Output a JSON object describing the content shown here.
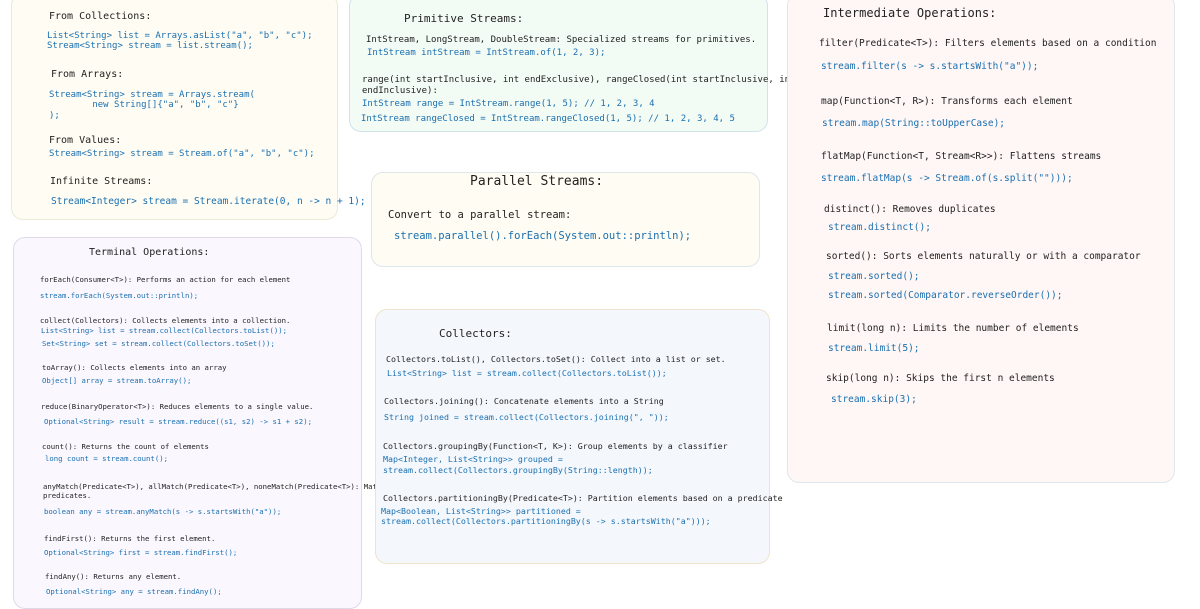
{
  "creation": {
    "from_collections": {
      "heading": "From Collections:",
      "code": [
        "List<String> list = Arrays.asList(\"a\", \"b\", \"c\");",
        "Stream<String> stream = list.stream();"
      ]
    },
    "from_arrays": {
      "heading": "From Arrays:",
      "code": [
        "Stream<String> stream = Arrays.stream(",
        "        new String[]{\"a\", \"b\", \"c\"}",
        ");"
      ]
    },
    "from_values": {
      "heading": "From Values:",
      "code": "Stream<String> stream = Stream.of(\"a\", \"b\", \"c\");"
    },
    "infinite": {
      "heading": "Infinite Streams:",
      "code": "Stream<Integer> stream = Stream.iterate(0, n -> n + 1);"
    }
  },
  "primitive": {
    "title": "Primitive Streams:",
    "desc1": "IntStream, LongStream, DoubleStream: Specialized streams for primitives.",
    "code1": "IntStream intStream = IntStream.of(1, 2, 3);",
    "desc2": [
      "range(int startInclusive, int endExclusive), rangeClosed(int startInclusive, int",
      "endInclusive):"
    ],
    "code2": "IntStream range = IntStream.range(1, 5); // 1, 2, 3, 4",
    "code3": "IntStream rangeClosed = IntStream.rangeClosed(1, 5); // 1, 2, 3, 4, 5"
  },
  "parallel": {
    "title": "Parallel Streams:",
    "desc": "Convert to a parallel stream:",
    "code": "stream.parallel().forEach(System.out::println);"
  },
  "terminal": {
    "title": "Terminal Operations:",
    "items": [
      {
        "desc": "forEach(Consumer<T>): Performs an action for each element",
        "code": [
          "stream.forEach(System.out::println);"
        ]
      },
      {
        "desc": "collect(Collectors): Collects elements into a collection.",
        "code": [
          "List<String> list = stream.collect(Collectors.toList());",
          "Set<String> set = stream.collect(Collectors.toSet());"
        ]
      },
      {
        "desc": "toArray(): Collects elements into an array",
        "code": [
          "Object[] array = stream.toArray();"
        ]
      },
      {
        "desc": "reduce(BinaryOperator<T>): Reduces elements to a single value.",
        "code": [
          "Optional<String> result = stream.reduce((s1, s2) -> s1 + s2);"
        ]
      },
      {
        "desc": "count(): Returns the count of elements",
        "code": [
          "long count = stream.count();"
        ]
      },
      {
        "desc": "anyMatch(Predicate<T>), allMatch(Predicate<T>), noneMatch(Predicate<T>): Match",
        "desc2": "predicates.",
        "code": [
          "boolean any = stream.anyMatch(s -> s.startsWith(\"a\"));"
        ]
      },
      {
        "desc": "findFirst(): Returns the first element.",
        "code": [
          "Optional<String> first = stream.findFirst();"
        ]
      },
      {
        "desc": "findAny(): Returns any element.",
        "code": [
          "Optional<String> any = stream.findAny();"
        ]
      }
    ]
  },
  "collectors": {
    "title": "Collectors:",
    "items": [
      {
        "desc": "Collectors.toList(), Collectors.toSet(): Collect into a list or set.",
        "code": [
          "List<String> list = stream.collect(Collectors.toList());"
        ]
      },
      {
        "desc": "Collectors.joining(): Concatenate elements into a String",
        "code": [
          "String joined = stream.collect(Collectors.joining(\", \"));"
        ]
      },
      {
        "desc": "Collectors.groupingBy(Function<T, K>): Group elements by a classifier",
        "code": [
          "Map<Integer, List<String>> grouped =",
          "stream.collect(Collectors.groupingBy(String::length));"
        ]
      },
      {
        "desc": "Collectors.partitioningBy(Predicate<T>): Partition elements based on a predicate",
        "code": [
          "Map<Boolean, List<String>> partitioned =",
          "stream.collect(Collectors.partitioningBy(s -> s.startsWith(\"a\")));"
        ]
      }
    ]
  },
  "intermediate": {
    "title": "Intermediate Operations:",
    "items": [
      {
        "desc": "filter(Predicate<T>): Filters elements based on a condition",
        "code": [
          "stream.filter(s -> s.startsWith(\"a\"));"
        ]
      },
      {
        "desc": "map(Function<T, R>): Transforms each element",
        "code": [
          "stream.map(String::toUpperCase);"
        ]
      },
      {
        "desc": "flatMap(Function<T, Stream<R>>): Flattens streams",
        "code": [
          "stream.flatMap(s -> Stream.of(s.split(\"\")));"
        ]
      },
      {
        "desc": "distinct(): Removes duplicates",
        "code": [
          "stream.distinct();"
        ]
      },
      {
        "desc": "sorted(): Sorts elements naturally or with a comparator",
        "code": [
          "stream.sorted();",
          "stream.sorted(Comparator.reverseOrder());"
        ]
      },
      {
        "desc": "limit(long n): Limits the number of elements",
        "code": [
          "stream.limit(5);"
        ]
      },
      {
        "desc": "skip(long n): Skips the first n elements",
        "code": [
          "stream.skip(3);"
        ]
      }
    ]
  }
}
